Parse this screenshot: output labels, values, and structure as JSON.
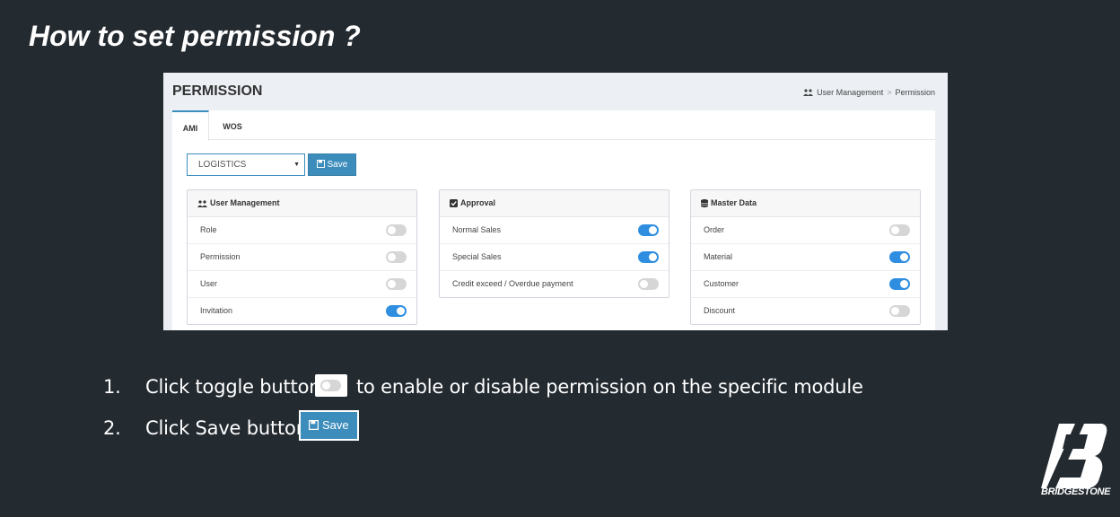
{
  "slide": {
    "title": "How to set permission ?"
  },
  "panel": {
    "page_title": "PERMISSION",
    "breadcrumb": [
      "User Management",
      "Permission"
    ],
    "tabs": [
      {
        "label": "AMI",
        "active": true
      },
      {
        "label": "WOS",
        "active": false
      }
    ],
    "role_select": {
      "value": "LOGISTICS"
    },
    "save_label": "Save",
    "cards": [
      {
        "title": "User Management",
        "icon": "users-icon",
        "items": [
          {
            "label": "Role",
            "on": false
          },
          {
            "label": "Permission",
            "on": false
          },
          {
            "label": "User",
            "on": false
          },
          {
            "label": "Invitation",
            "on": true
          }
        ]
      },
      {
        "title": "Approval",
        "icon": "check-square-icon",
        "items": [
          {
            "label": "Normal Sales",
            "on": true
          },
          {
            "label": "Special Sales",
            "on": true
          },
          {
            "label": "Credit exceed / Overdue payment",
            "on": false
          }
        ]
      },
      {
        "title": "Master Data",
        "icon": "database-icon",
        "items": [
          {
            "label": "Order",
            "on": false
          },
          {
            "label": "Material",
            "on": true
          },
          {
            "label": "Customer",
            "on": true
          },
          {
            "label": "Discount",
            "on": false
          }
        ]
      }
    ]
  },
  "instructions": [
    {
      "num": "1.",
      "before": "Click toggle button",
      "after": "to enable or disable permission on the specific module"
    },
    {
      "num": "2.",
      "before": "Click Save button",
      "button_label": "Save"
    }
  ],
  "brand": {
    "name": "BRIDGESTONE",
    "logo_mark": "B"
  },
  "colors": {
    "background": "#232a30",
    "accent": "#3c8dbc",
    "toggle_on": "#2f8ee0",
    "toggle_off": "#d6d6d6"
  }
}
